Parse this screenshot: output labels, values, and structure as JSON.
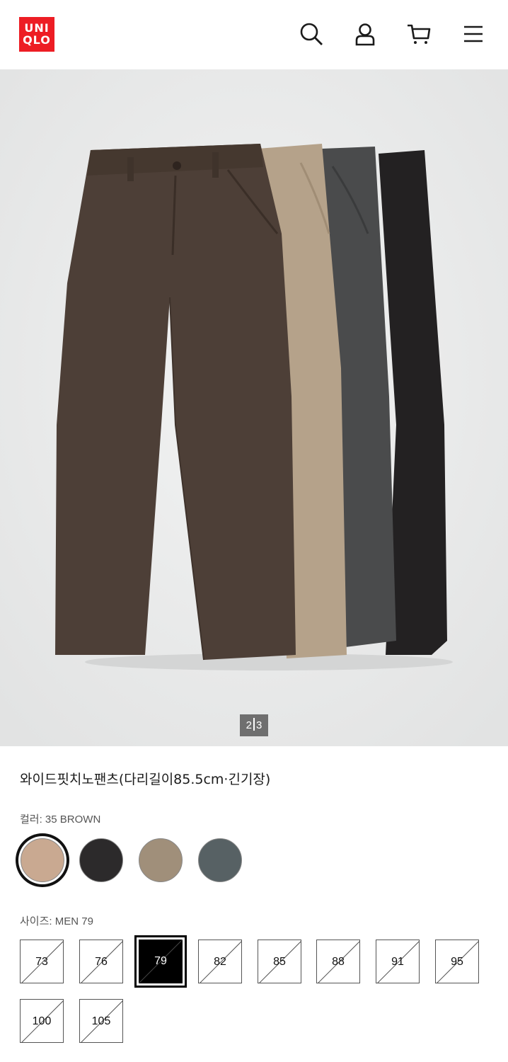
{
  "header": {
    "logo_line1": "UNI",
    "logo_line2": "QLO",
    "icons": [
      "search-icon",
      "account-icon",
      "cart-icon",
      "menu-icon"
    ]
  },
  "gallery": {
    "current": "2",
    "total": "3"
  },
  "product": {
    "title": "와이드핏치노팬츠(다리길이85.5cm·긴기장)"
  },
  "colour": {
    "label": "컬러: 35 BROWN",
    "swatches": [
      {
        "color": "#c9a991",
        "selected": true
      },
      {
        "color": "#2c2a2b",
        "selected": false
      },
      {
        "color": "#a08f7a",
        "selected": false
      },
      {
        "color": "#576164",
        "selected": false
      }
    ]
  },
  "size": {
    "label": "사이즈: MEN 79",
    "options": [
      "73",
      "76",
      "79",
      "82",
      "85",
      "88",
      "91",
      "95",
      "100",
      "105"
    ],
    "selected": "79"
  },
  "colors": {
    "brand_red": "#ed1d24",
    "hero_bg": "#e9eaea"
  }
}
